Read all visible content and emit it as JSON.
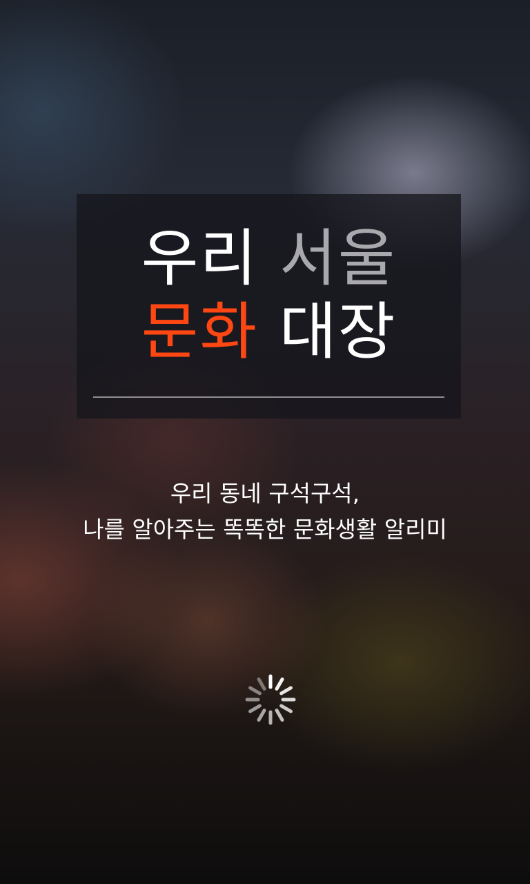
{
  "splash": {
    "title": {
      "line1_white": "우리",
      "line1_gray": "서울",
      "line2_orange": "문화",
      "line2_white": "대장"
    },
    "tagline": {
      "line1": "우리 동네 구석구석,",
      "line2": "나를 알아주는 똑똑한 문화생활 알리미"
    },
    "loading_indicator": "spinner-icon"
  },
  "colors": {
    "accent": "#ff4713",
    "title_gray": "#a9a9ad",
    "text": "#ffffff"
  }
}
